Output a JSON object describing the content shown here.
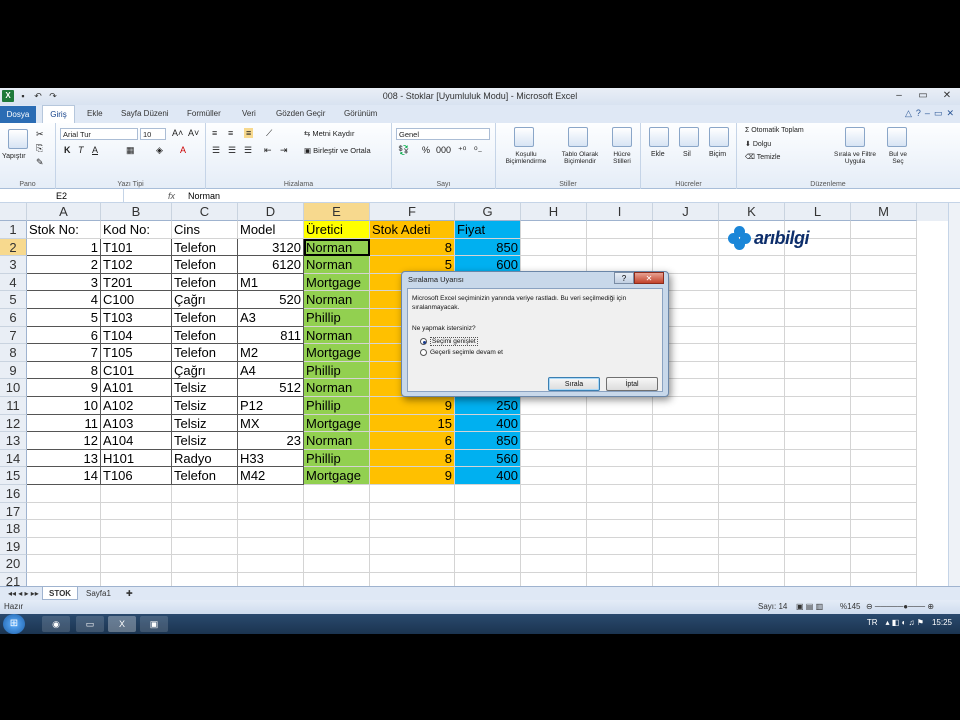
{
  "window": {
    "title": "008 - Stoklar  [Uyumluluk Modu]  -  Microsoft Excel"
  },
  "tabs": [
    "Dosya",
    "Giriş",
    "Ekle",
    "Sayfa Düzeni",
    "Formüller",
    "Veri",
    "Gözden Geçir",
    "Görünüm"
  ],
  "ribbon": {
    "paste": "Yapıştır",
    "font_name": "Arial Tur",
    "font_size": "10",
    "wrap_text": "Metni Kaydır",
    "merge": "Birleştir ve Ortala",
    "number_format": "Genel",
    "cond_format": "Koşullu Biçimlendirme",
    "table_format": "Tablo Olarak Biçimlendir",
    "cell_styles": "Hücre Stilleri",
    "insert": "Ekle",
    "delete": "Sil",
    "format": "Biçim",
    "autosum": "Otomatik Toplam",
    "fill": "Dolgu",
    "clear": "Temizle",
    "sort_filter": "Sırala ve Filtre Uygula",
    "find_select": "Bul ve Seç",
    "groups": [
      "Pano",
      "Yazı Tipi",
      "Hizalama",
      "Sayı",
      "Stiller",
      "Hücreler",
      "Düzenleme"
    ]
  },
  "formula_bar": {
    "name_box": "E2",
    "fx": "fx",
    "value": "Norman"
  },
  "columns": [
    "A",
    "B",
    "C",
    "D",
    "E",
    "F",
    "G",
    "H",
    "I",
    "J",
    "K",
    "L",
    "M"
  ],
  "rows": [
    "1",
    "2",
    "3",
    "4",
    "5",
    "6",
    "7",
    "8",
    "9",
    "10",
    "11",
    "12",
    "13",
    "14",
    "15",
    "16",
    "17",
    "18",
    "19",
    "20",
    "21"
  ],
  "headers": [
    "Stok No:",
    "Kod No:",
    "Cins",
    "Model",
    "Üretici",
    "Stok Adeti",
    "Fiyat"
  ],
  "table": [
    [
      "1",
      "T101",
      "Telefon",
      "3120",
      "Norman",
      "8",
      "850"
    ],
    [
      "2",
      "T102",
      "Telefon",
      "6120",
      "Norman",
      "5",
      "600"
    ],
    [
      "3",
      "T201",
      "Telefon",
      "M1",
      "Mortgage",
      "",
      ""
    ],
    [
      "4",
      "C100",
      "Çağrı",
      "520",
      "Norman",
      "",
      ""
    ],
    [
      "5",
      "T103",
      "Telefon",
      "A3",
      "Phillip",
      "",
      ""
    ],
    [
      "6",
      "T104",
      "Telefon",
      "811",
      "Norman",
      "",
      ""
    ],
    [
      "7",
      "T105",
      "Telefon",
      "M2",
      "Mortgage",
      "",
      ""
    ],
    [
      "8",
      "C101",
      "Çağrı",
      "A4",
      "Phillip",
      "",
      ""
    ],
    [
      "9",
      "A101",
      "Telsiz",
      "512",
      "Norman",
      "",
      ""
    ],
    [
      "10",
      "A102",
      "Telsiz",
      "P12",
      "Phillip",
      "9",
      "250"
    ],
    [
      "11",
      "A103",
      "Telsiz",
      "MX",
      "Mortgage",
      "15",
      "400"
    ],
    [
      "12",
      "A104",
      "Telsiz",
      "23",
      "Norman",
      "6",
      "850"
    ],
    [
      "13",
      "H101",
      "Radyo",
      "H33",
      "Phillip",
      "8",
      "560"
    ],
    [
      "14",
      "T106",
      "Telefon",
      "M42",
      "Mortgage",
      "9",
      "400"
    ]
  ],
  "logo": {
    "text": "arıbilgi"
  },
  "sheets": [
    "STOK",
    "Sayfa1"
  ],
  "status": {
    "ready": "Hazır",
    "count": "Sayı: 14",
    "zoom": "%145"
  },
  "taskbar": {
    "lang": "TR",
    "time": "15:25"
  },
  "dialog": {
    "title": "Sıralama Uyarısı",
    "message": "Microsoft Excel seçiminizin yanında veriye rastladı. Bu veri seçilmediği için sıralanmayacak.",
    "question": "Ne yapmak istersiniz?",
    "option1": "Seçimi genişlet",
    "option2": "Geçerli seçimle devam et",
    "ok": "Sırala",
    "cancel": "İptal"
  },
  "colors": {
    "yellow": "#ffff00",
    "orange": "#ffc000",
    "blue": "#00b0f0",
    "green": "#92d050"
  }
}
